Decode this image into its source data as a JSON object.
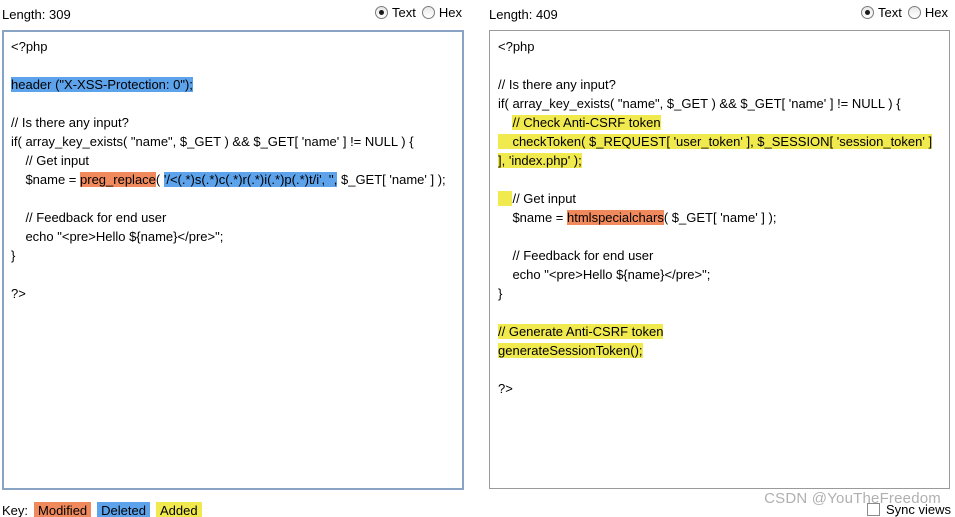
{
  "colors": {
    "modified": "#f08a5d",
    "deleted": "#5da3ec",
    "added": "#f1ea4f",
    "left_border": "#88a3c4"
  },
  "left": {
    "length_label": "Length: 309",
    "mode_text": "Text",
    "mode_hex": "Hex",
    "selected_mode": "Text",
    "lines": [
      [
        {
          "t": "<?php",
          "h": ""
        }
      ],
      [
        {
          "t": "",
          "h": ""
        }
      ],
      [
        {
          "t": "header (\"X-XSS-Protection: 0\");",
          "h": "del"
        }
      ],
      [
        {
          "t": "",
          "h": ""
        }
      ],
      [
        {
          "t": "// Is there any input?",
          "h": ""
        }
      ],
      [
        {
          "t": "if( array_key_exists( \"name\", $_GET ) && $_GET[ 'name' ] != NULL ) {",
          "h": ""
        }
      ],
      [
        {
          "t": "    // Get input",
          "h": ""
        }
      ],
      [
        {
          "t": "    $name = ",
          "h": ""
        },
        {
          "t": "preg_replace",
          "h": "mod"
        },
        {
          "t": "( ",
          "h": ""
        },
        {
          "t": "'/<(.*)s(.*)c(.*)r(.*)i(.*)p(.*)t/i', '',",
          "h": "del"
        },
        {
          "t": " $_GET[ 'name' ] );",
          "h": ""
        }
      ],
      [
        {
          "t": "",
          "h": ""
        }
      ],
      [
        {
          "t": "    // Feedback for end user",
          "h": ""
        }
      ],
      [
        {
          "t": "    echo \"<pre>Hello ${name}</pre>\";",
          "h": ""
        }
      ],
      [
        {
          "t": "}",
          "h": ""
        }
      ],
      [
        {
          "t": "",
          "h": ""
        }
      ],
      [
        {
          "t": "?>",
          "h": ""
        }
      ]
    ]
  },
  "right": {
    "length_label": "Length: 409",
    "mode_text": "Text",
    "mode_hex": "Hex",
    "selected_mode": "Text",
    "lines": [
      [
        {
          "t": "<?php",
          "h": ""
        }
      ],
      [
        {
          "t": "",
          "h": ""
        }
      ],
      [
        {
          "t": "// Is there any input?",
          "h": ""
        }
      ],
      [
        {
          "t": "if( array_key_exists( \"name\", $_GET ) && $_GET[ 'name' ] != NULL ) {",
          "h": ""
        }
      ],
      [
        {
          "t": "    ",
          "h": ""
        },
        {
          "t": "// Check Anti-CSRF token",
          "h": "add"
        }
      ],
      [
        {
          "t": "    checkToken( $_REQUEST[ 'user_token' ], $_SESSION[ 'session_token' ]",
          "h": "add"
        }
      ],
      [
        {
          "t": "], 'index.php' );",
          "h": "add"
        }
      ],
      [
        {
          "t": "",
          "h": ""
        }
      ],
      [
        {
          "t": "    ",
          "h": "add"
        },
        {
          "t": "// Get input",
          "h": ""
        }
      ],
      [
        {
          "t": "    $name = ",
          "h": ""
        },
        {
          "t": "htmlspecialchars",
          "h": "mod"
        },
        {
          "t": "( $_GET[ 'name' ] );",
          "h": ""
        }
      ],
      [
        {
          "t": "",
          "h": ""
        }
      ],
      [
        {
          "t": "    // Feedback for end user",
          "h": ""
        }
      ],
      [
        {
          "t": "    echo \"<pre>Hello ${name}</pre>\";",
          "h": ""
        }
      ],
      [
        {
          "t": "}",
          "h": ""
        }
      ],
      [
        {
          "t": "",
          "h": ""
        }
      ],
      [
        {
          "t": "// Generate Anti-CSRF token",
          "h": "add"
        }
      ],
      [
        {
          "t": "generateSessionToken();",
          "h": "add"
        }
      ],
      [
        {
          "t": "",
          "h": ""
        }
      ],
      [
        {
          "t": "?>",
          "h": ""
        }
      ]
    ]
  },
  "key": {
    "label": "Key:",
    "modified": "Modified",
    "deleted": "Deleted",
    "added": "Added"
  },
  "sync": {
    "label": "Sync views",
    "checked": false
  },
  "watermark": "CSDN @YouTheFreedom"
}
